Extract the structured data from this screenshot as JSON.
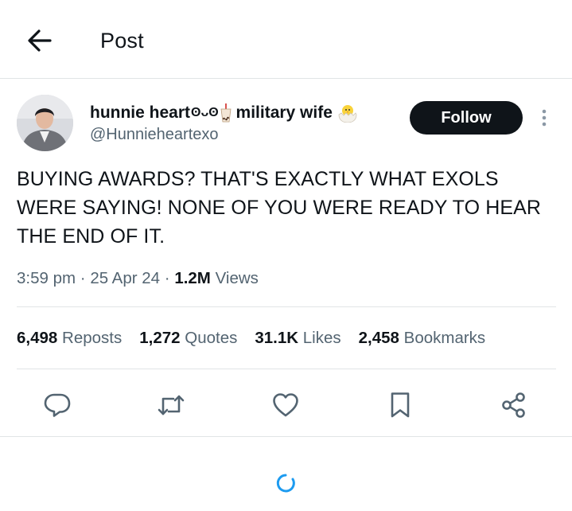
{
  "header": {
    "title": "Post",
    "back_icon": "arrow-left-icon"
  },
  "author": {
    "name_prefix": "hunnie heart",
    "name_suffix": " military wife",
    "emoji_1": "ʘᴗʘ",
    "emoji_2": "🧋",
    "emoji_3": "🐣",
    "handle": "@Hunnieheartexo",
    "follow_label": "Follow",
    "more_icon": "more-vertical-icon"
  },
  "post": {
    "text": "BUYING AWARDS? THAT'S EXACTLY WHAT EXOLS WERE SAYING! NONE OF YOU WERE READY TO HEAR THE END OF IT.",
    "time": "3:59 pm",
    "date": "25 Apr 24",
    "views_count": "1.2M",
    "views_label": "Views",
    "separator": "·"
  },
  "stats": [
    {
      "count": "6,498",
      "label": "Reposts"
    },
    {
      "count": "1,272",
      "label": "Quotes"
    },
    {
      "count": "31.1K",
      "label": "Likes"
    },
    {
      "count": "2,458",
      "label": "Bookmarks"
    }
  ],
  "actions": [
    "reply-icon",
    "repost-icon",
    "like-icon",
    "bookmark-icon",
    "share-icon"
  ],
  "colors": {
    "text": "#0f1419",
    "secondary": "#536471",
    "divider": "#e1e4e6",
    "follow_bg": "#0f1419",
    "loader": "#1d9bf0"
  }
}
